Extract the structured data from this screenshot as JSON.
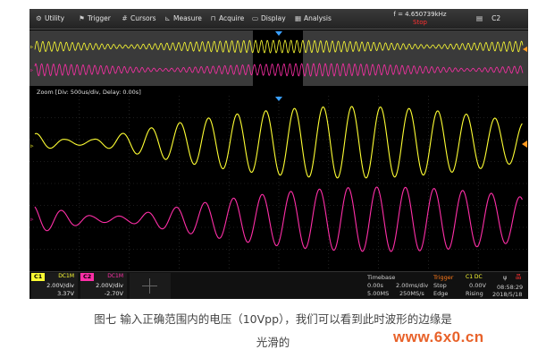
{
  "menu": {
    "utility": "Utility",
    "trigger": "Trigger",
    "cursors": "Cursors",
    "measure": "Measure",
    "acquire": "Acquire",
    "display": "Display",
    "analysis": "Analysis"
  },
  "freq": "f = 4.650739kHz",
  "run_state": "Stop",
  "channel_tab": "C2",
  "zoom_label": "Zoom [Div: 500us/div,  Delay: 0.00s]",
  "colors": {
    "ch1": "#ffff33",
    "ch2": "#ff2fa8",
    "trigger": "#ff7a1a",
    "timebase": "#d0d0d0"
  },
  "ch1": {
    "tag": "C1",
    "coupling": "DC1M",
    "scale": "2.00V/div",
    "offset": "3.37V"
  },
  "ch2": {
    "tag": "C2",
    "coupling": "DC1M",
    "scale": "2.00V/div",
    "offset": "-2.70V"
  },
  "timebase": {
    "title": "Timebase",
    "delay": "0.00s",
    "div": "2.00ms/div",
    "points": "5.00MS",
    "rate": "250MS/s"
  },
  "trigger": {
    "title": "Trigger",
    "ch": "C1 DC",
    "mode": "Stop",
    "level": "0.00V",
    "type": "Edge",
    "slope": "Rising"
  },
  "clock": {
    "time": "08:58:29",
    "date": "2018/5/18"
  },
  "caption_line1": "图七  输入正确范围内的电压（10Vpp），我们可以看到此时波形的边缘是",
  "caption_line2": "光滑的",
  "watermark": "www.6x0.cn"
}
